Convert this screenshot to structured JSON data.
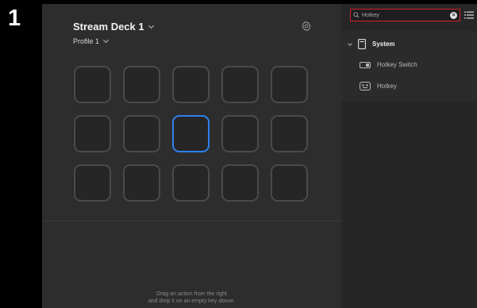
{
  "step_number": "1",
  "deck": {
    "title": "Stream Deck 1",
    "profile": "Profile 1"
  },
  "grid": {
    "rows": 3,
    "cols": 5,
    "selected_index": 7
  },
  "hint": {
    "line1": "Drag an action from the right",
    "line2": "and drop it on an empty key above."
  },
  "sidebar": {
    "search": {
      "value": "Hotkey",
      "placeholder": "Search"
    },
    "category": {
      "label": "System",
      "icon": "system-icon",
      "expanded": true
    },
    "actions": [
      {
        "label": "Hotkey Switch",
        "icon": "hotkey-switch-icon"
      },
      {
        "label": "Hotkey",
        "icon": "hotkey-icon"
      }
    ]
  },
  "colors": {
    "accent": "#2f7ff0",
    "search_border": "#d0212c",
    "background": "#2d2d2d",
    "sidebar": "#262626"
  }
}
